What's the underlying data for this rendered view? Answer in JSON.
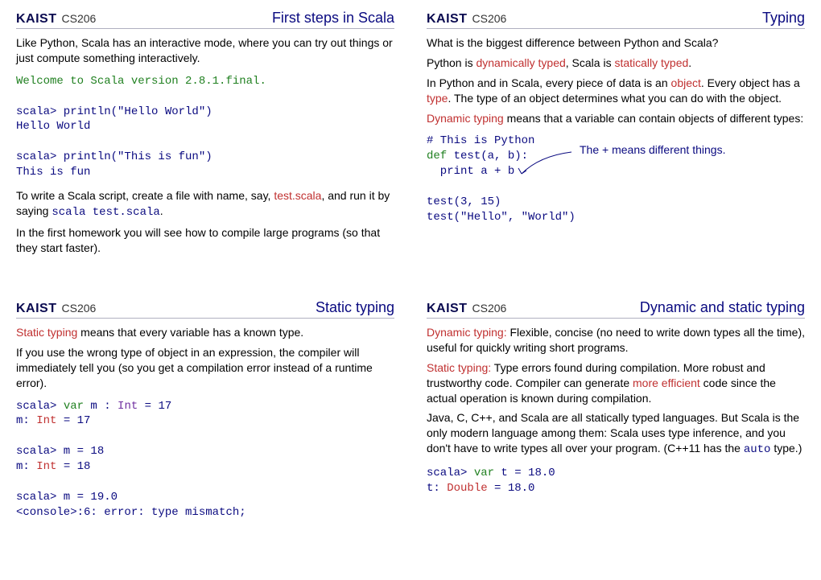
{
  "brand": "KAIST",
  "course": "CS206",
  "slides": [
    {
      "title": "First steps in Scala",
      "p1": "Like Python, Scala has an interactive mode, where you can try out things or just compute something interactively.",
      "code1_l1": "Welcome to Scala version 2.8.1.final.",
      "code1_l2": "scala> println(\"Hello World\")",
      "code1_l3": "Hello World",
      "code1_l4": "scala> println(\"This is fun\")",
      "code1_l5": "This is fun",
      "p2a": "To write a Scala script, create a file with name, say, ",
      "p2b": "test.scala",
      "p2c": ", and run it by saying ",
      "p2d": "scala test.scala",
      "p2e": ".",
      "p3": "In the first homework you will see how to compile large programs (so that they start faster)."
    },
    {
      "title": "Typing",
      "p1": "What is the biggest difference between Python and Scala?",
      "p2a": "Python is ",
      "p2b": "dynamically typed",
      "p2c": ", Scala is ",
      "p2d": "statically typed",
      "p2e": ".",
      "p3a": "In Python and in Scala, every piece of data is an ",
      "p3b": "object",
      "p3c": ". Every object has a ",
      "p3d": "type",
      "p3e": ". The type of an object determines what you can do with the object.",
      "p4a": "Dynamic typing",
      "p4b": " means that a variable can contain objects of different types:",
      "code_l1": "# This is Python",
      "code_l2a": "def",
      "code_l2b": " test(a, b):",
      "code_l3": "  print a + b",
      "code_l4": "test(3, 15)",
      "code_l5": "test(\"Hello\", \"World\")",
      "annot": "The + means different things."
    },
    {
      "title": "Static typing",
      "p1a": "Static typing",
      "p1b": " means that every variable has a known type.",
      "p2": "If you use the wrong type of object in an expression, the compiler will immediately tell you (so you get a compilation error instead of a runtime error).",
      "code_l1a": "scala> ",
      "code_l1b": "var",
      "code_l1c": " m : ",
      "code_l1d": "Int",
      "code_l1e": " = 17",
      "code_l2a": "m: ",
      "code_l2b": "Int",
      "code_l2c": " = 17",
      "code_l3": "scala> m = 18",
      "code_l4a": "m: ",
      "code_l4b": "Int",
      "code_l4c": " = 18",
      "code_l5": "scala> m = 19.0",
      "code_l6": "<console>:6: error: type mismatch;"
    },
    {
      "title": "Dynamic and static typing",
      "p1a": "Dynamic typing:",
      "p1b": " Flexible, concise (no need to write down types all the time), useful for quickly writing short programs.",
      "p2a": "Static typing:",
      "p2b": " Type errors found during compilation. More robust and trustworthy code. Compiler can generate ",
      "p2c": "more efficient",
      "p2d": " code since the actual operation is known during compilation.",
      "p3a": "Java, C, C++, and Scala are all statically typed languages. But Scala is the only modern language among them: Scala uses type inference, and you don't have to write types all over your program. (C++11 has the ",
      "p3b": "auto",
      "p3c": " type.)",
      "code_l1a": "scala> ",
      "code_l1b": "var",
      "code_l1c": " t = 18.0",
      "code_l2a": "t: ",
      "code_l2b": "Double",
      "code_l2c": " = 18.0"
    }
  ]
}
